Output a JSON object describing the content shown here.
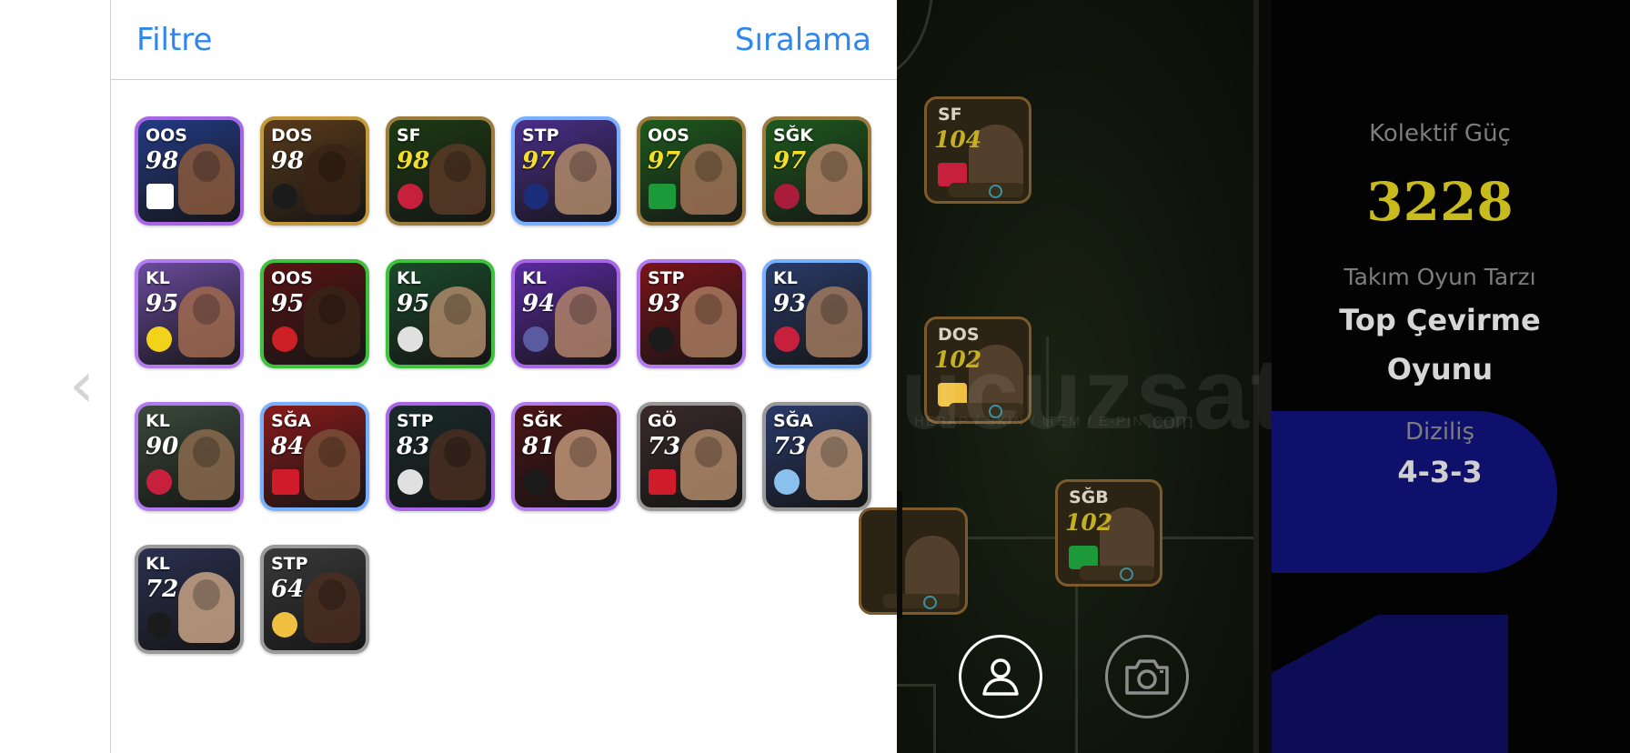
{
  "panel": {
    "filter_label": "Filtre",
    "sort_label": "Sıralama"
  },
  "cards": [
    {
      "pos": "OOS",
      "rating": "98",
      "frame": "#a866e6",
      "bg": "#233b86",
      "face": "#8a5a3e",
      "badge": "#ffffff",
      "badge_shape": "flag"
    },
    {
      "pos": "DOS",
      "rating": "98",
      "frame": "#c29a3c",
      "bg": "#5a3a1a",
      "face": "#3a2416",
      "badge": "#1b1b1b",
      "badge_shape": "round"
    },
    {
      "pos": "SF",
      "rating": "98",
      "frame": "#9c7b3c",
      "bg": "#1d3a14",
      "face": "#5a3a26",
      "badge": "#c6203c",
      "badge_shape": "round",
      "gold": true
    },
    {
      "pos": "STP",
      "rating": "97",
      "frame": "#78b0ff",
      "bg": "#4a2f8a",
      "face": "#b08a6a",
      "badge": "#1c2e7a",
      "badge_shape": "round",
      "gold": true
    },
    {
      "pos": "OOS",
      "rating": "97",
      "frame": "#9c7b3c",
      "bg": "#1e5a1e",
      "face": "#a07356",
      "badge": "#1c9a3a",
      "badge_shape": "flag",
      "gold": true
    },
    {
      "pos": "SĞK",
      "rating": "97",
      "frame": "#9c7b3c",
      "bg": "#1e5a1e",
      "face": "#b7876a",
      "badge": "#a81c3c",
      "badge_shape": "round",
      "gold": true
    },
    {
      "pos": "KL",
      "rating": "95",
      "frame": "#b27cf0",
      "bg": "#6a4b9c",
      "face": "#a06a50",
      "badge": "#f3d21a",
      "badge_shape": "round"
    },
    {
      "pos": "OOS",
      "rating": "95",
      "frame": "#3ec23e",
      "bg": "#5a1414",
      "face": "#3a2418",
      "badge": "#cc2026",
      "badge_shape": "round"
    },
    {
      "pos": "KL",
      "rating": "95",
      "frame": "#3ec23e",
      "bg": "#1a4a2a",
      "face": "#b08a6a",
      "badge": "#e0e0e0",
      "badge_shape": "round"
    },
    {
      "pos": "KL",
      "rating": "94",
      "frame": "#a866e6",
      "bg": "#5a2aa0",
      "face": "#b0826a",
      "badge": "#5a5aa0",
      "badge_shape": "round"
    },
    {
      "pos": "STP",
      "rating": "93",
      "frame": "#b27cf0",
      "bg": "#7a1418",
      "face": "#a87a5e",
      "badge": "#1b1b1b",
      "badge_shape": "round"
    },
    {
      "pos": "KL",
      "rating": "93",
      "frame": "#78b0ff",
      "bg": "#2a3b6a",
      "face": "#a07a5e",
      "badge": "#c6203c",
      "badge_shape": "round"
    },
    {
      "pos": "KL",
      "rating": "90",
      "frame": "#b27cf0",
      "bg": "#3a4a3a",
      "face": "#8a6a4e",
      "badge": "#c6203c",
      "badge_shape": "round"
    },
    {
      "pos": "SĞA",
      "rating": "84",
      "frame": "#78b0ff",
      "bg": "#8a1a1a",
      "face": "#7a5038",
      "badge": "#d01b2a",
      "badge_shape": "flag"
    },
    {
      "pos": "STP",
      "rating": "83",
      "frame": "#a866e6",
      "bg": "#1a2a2a",
      "face": "#4a2e22",
      "badge": "#e0e0e0",
      "badge_shape": "round"
    },
    {
      "pos": "SĞK",
      "rating": "81",
      "frame": "#b27cf0",
      "bg": "#4a1414",
      "face": "#c09478",
      "badge": "#1b1b1b",
      "badge_shape": "round"
    },
    {
      "pos": "GÖ",
      "rating": "73",
      "frame": "#9a9a9a",
      "bg": "#3a2a2a",
      "face": "#b08a6a",
      "badge": "#d01b2a",
      "badge_shape": "flag"
    },
    {
      "pos": "SĞA",
      "rating": "73",
      "frame": "#9a9a9a",
      "bg": "#2a3a6a",
      "face": "#c8a07e",
      "badge": "#8ac0ee",
      "badge_shape": "round"
    },
    {
      "pos": "KL",
      "rating": "72",
      "frame": "#9a9a9a",
      "bg": "#2a3050",
      "face": "#c8a486",
      "badge": "#1b1b1b",
      "badge_shape": "round"
    },
    {
      "pos": "STP",
      "rating": "64",
      "frame": "#9a9a9a",
      "bg": "#3a3a3a",
      "face": "#4a2e22",
      "badge": "#f0c040",
      "badge_shape": "round"
    }
  ],
  "lineup": [
    {
      "pos": "SF",
      "rating": "104",
      "badge": "#c6203c"
    },
    {
      "pos": "DOS",
      "rating": "102",
      "badge": "#f0c040"
    },
    {
      "pos": "SĞB",
      "rating": "102",
      "badge": "#1c9a3a"
    },
    {
      "pos": "",
      "rating": "",
      "badge": "#b01c1c"
    }
  ],
  "watermark": {
    "text": "ucuzsatış",
    "sub": "HESAP / SKIN / ITEM / E-PIN",
    "domain": ".com"
  },
  "team": {
    "power_label": "Kolektif Güç",
    "power_value": "3228",
    "style_label": "Takım Oyun Tarzı",
    "style_value_line1": "Top Çevirme",
    "style_value_line2": "Oyunu",
    "formation_label": "Diziliş",
    "formation_value": "4-3-3"
  },
  "icons": {
    "back": "chevron-left-icon",
    "profile": "user-icon",
    "camera": "camera-icon"
  },
  "colors": {
    "accent": "#2e86ee",
    "power": "#c8bb1e",
    "pill": "#0f106b"
  }
}
